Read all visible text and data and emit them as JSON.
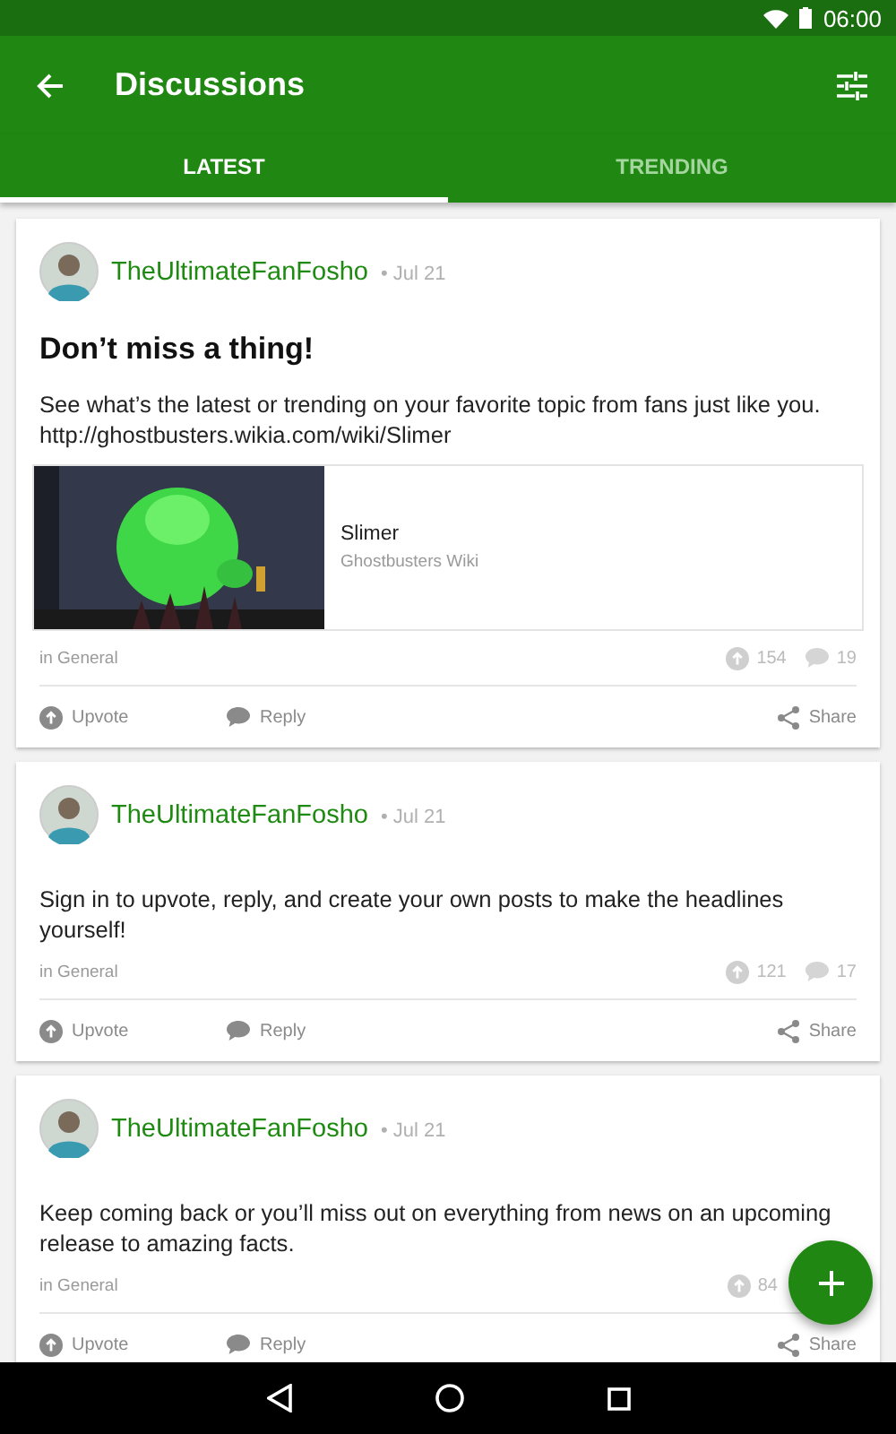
{
  "status_bar": {
    "time": "06:00"
  },
  "toolbar": {
    "title": "Discussions"
  },
  "tabs": [
    {
      "label": "LATEST",
      "selected": true
    },
    {
      "label": "TRENDING",
      "selected": false
    }
  ],
  "posts": [
    {
      "author": "TheUltimateFanFosho",
      "date": "• Jul 21",
      "title": "Don’t miss a thing!",
      "body": "See what’s the latest or trending on your favorite topic from fans just like you.",
      "link": "http://ghostbusters.wikia.com/wiki/Slimer",
      "preview": {
        "kind": "picture",
        "title": "Slimer",
        "source": "Ghostbusters Wiki"
      },
      "category": "in General",
      "upvotes": "154",
      "replies": "19",
      "actions": [
        "Upvote",
        "Reply",
        "Share"
      ]
    },
    {
      "author": "TheUltimateFanFosho",
      "date": "• Jul 21",
      "body": "Sign in to upvote, reply, and create your own posts to make the headlines yourself!",
      "category": "in General",
      "upvotes": "121",
      "replies": "17",
      "actions": [
        "Upvote",
        "Reply",
        "Share"
      ]
    },
    {
      "author": "TheUltimateFanFosho",
      "date": "• Jul 21",
      "body": "Keep coming back or you’ll miss out on everything from news on an upcoming release to amazing facts.",
      "category": "in General",
      "upvotes": "84",
      "actions": [
        "Upvote",
        "Reply",
        "Share"
      ]
    }
  ]
}
